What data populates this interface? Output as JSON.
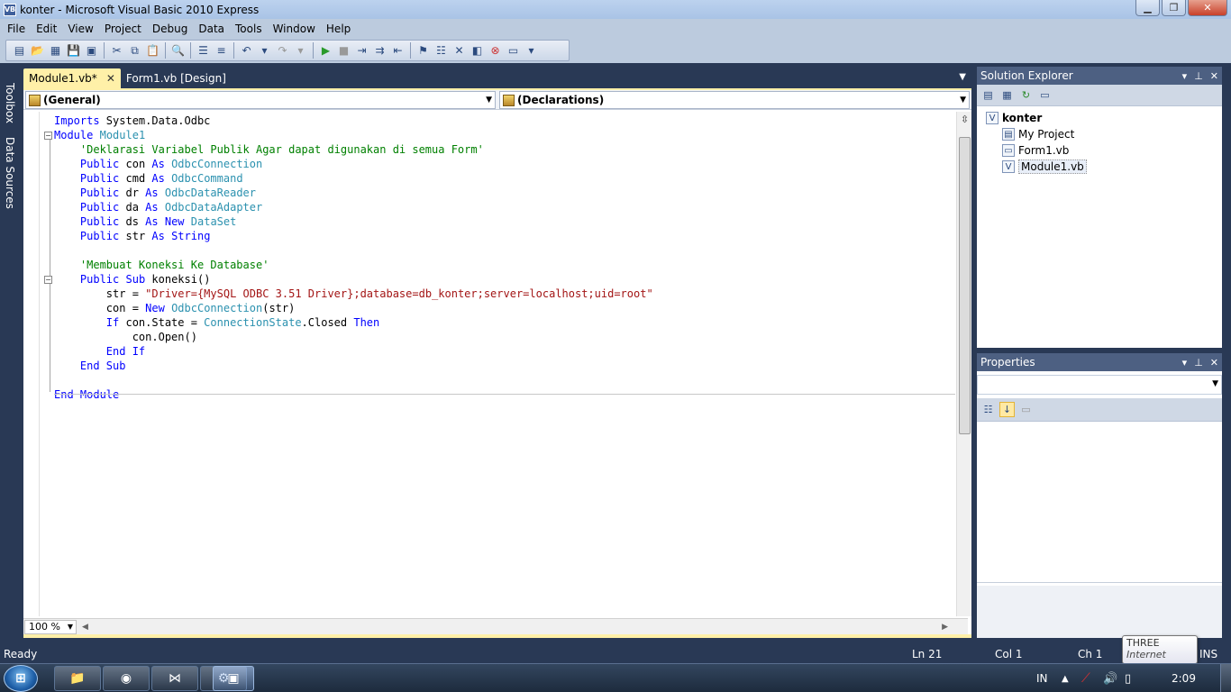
{
  "window": {
    "title": "konter - Microsoft Visual Basic 2010 Express",
    "app_icon": "VB"
  },
  "menu": [
    "File",
    "Edit",
    "View",
    "Project",
    "Debug",
    "Data",
    "Tools",
    "Window",
    "Help"
  ],
  "side_tabs": [
    "Toolbox",
    "Data Sources"
  ],
  "doc_tabs": [
    {
      "label": "Module1.vb*",
      "active": true
    },
    {
      "label": "Form1.vb [Design]",
      "active": false
    }
  ],
  "nav": {
    "left": "(General)",
    "right": "(Declarations)"
  },
  "code_lines": [
    [
      [
        "kw",
        "Imports"
      ],
      [
        "",
        " System.Data.Odbc"
      ]
    ],
    [
      [
        "kw",
        "Module"
      ],
      [
        "",
        " "
      ],
      [
        "ty",
        "Module1"
      ]
    ],
    [
      [
        "",
        "    "
      ],
      [
        "cm",
        "'Deklarasi Variabel Publik Agar dapat digunakan di semua Form'"
      ]
    ],
    [
      [
        "",
        "    "
      ],
      [
        "kw",
        "Public"
      ],
      [
        "",
        " con "
      ],
      [
        "kw",
        "As"
      ],
      [
        "",
        " "
      ],
      [
        "ty",
        "OdbcConnection"
      ]
    ],
    [
      [
        "",
        "    "
      ],
      [
        "kw",
        "Public"
      ],
      [
        "",
        " cmd "
      ],
      [
        "kw",
        "As"
      ],
      [
        "",
        " "
      ],
      [
        "ty",
        "OdbcCommand"
      ]
    ],
    [
      [
        "",
        "    "
      ],
      [
        "kw",
        "Public"
      ],
      [
        "",
        " dr "
      ],
      [
        "kw",
        "As"
      ],
      [
        "",
        " "
      ],
      [
        "ty",
        "OdbcDataReader"
      ]
    ],
    [
      [
        "",
        "    "
      ],
      [
        "kw",
        "Public"
      ],
      [
        "",
        " da "
      ],
      [
        "kw",
        "As"
      ],
      [
        "",
        " "
      ],
      [
        "ty",
        "OdbcDataAdapter"
      ]
    ],
    [
      [
        "",
        "    "
      ],
      [
        "kw",
        "Public"
      ],
      [
        "",
        " ds "
      ],
      [
        "kw",
        "As"
      ],
      [
        "",
        " "
      ],
      [
        "kw",
        "New"
      ],
      [
        "",
        " "
      ],
      [
        "ty",
        "DataSet"
      ]
    ],
    [
      [
        "",
        "    "
      ],
      [
        "kw",
        "Public"
      ],
      [
        "",
        " str "
      ],
      [
        "kw",
        "As"
      ],
      [
        "",
        " "
      ],
      [
        "kw",
        "String"
      ]
    ],
    [],
    [
      [
        "",
        "    "
      ],
      [
        "cm",
        "'Membuat Koneksi Ke Database'"
      ]
    ],
    [
      [
        "",
        "    "
      ],
      [
        "kw",
        "Public"
      ],
      [
        "",
        " "
      ],
      [
        "kw",
        "Sub"
      ],
      [
        "",
        " koneksi()"
      ]
    ],
    [
      [
        "",
        "        str = "
      ],
      [
        "st",
        "\"Driver={MySQL ODBC 3.51 Driver};database=db_konter;server=localhost;uid=root\""
      ]
    ],
    [
      [
        "",
        "        con = "
      ],
      [
        "kw",
        "New"
      ],
      [
        "",
        " "
      ],
      [
        "ty",
        "OdbcConnection"
      ],
      [
        "",
        "(str)"
      ]
    ],
    [
      [
        "",
        "        "
      ],
      [
        "kw",
        "If"
      ],
      [
        "",
        " con.State = "
      ],
      [
        "ty",
        "ConnectionState"
      ],
      [
        "",
        ".Closed "
      ],
      [
        "kw",
        "Then"
      ]
    ],
    [
      [
        "",
        "            con.Open()"
      ]
    ],
    [
      [
        "",
        "        "
      ],
      [
        "kw",
        "End If"
      ]
    ],
    [
      [
        "",
        "    "
      ],
      [
        "kw",
        "End Sub"
      ]
    ],
    [],
    [
      [
        "kw",
        "End Module"
      ]
    ]
  ],
  "zoom": "100 %",
  "solution_explorer": {
    "title": "Solution Explorer",
    "root": "konter",
    "items": [
      "My Project",
      "Form1.vb",
      "Module1.vb"
    ],
    "selected": "Module1.vb"
  },
  "properties": {
    "title": "Properties"
  },
  "status": {
    "ready": "Ready",
    "line": "Ln 21",
    "col": "Col 1",
    "ch": "Ch 1",
    "ins": "INS"
  },
  "tooltip": {
    "title": "THREE",
    "sub": "Internet access"
  },
  "taskbar": {
    "lang": "IN",
    "time": "2:09"
  },
  "colors": {
    "accent_tab": "#fff0a8",
    "chrome": "#293955",
    "keyword": "#0000ff",
    "type": "#2b91af",
    "comment": "#008000",
    "string": "#a31515"
  }
}
